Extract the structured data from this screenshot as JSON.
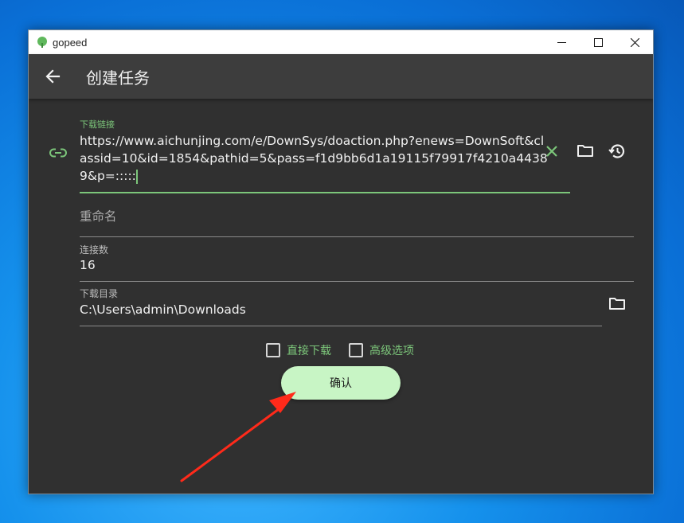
{
  "window": {
    "title": "gopeed"
  },
  "appbar": {
    "title": "创建任务"
  },
  "form": {
    "url_label": "下载链接",
    "url_value": "https://www.aichunjing.com/e/DownSys/doaction.php?enews=DownSoft&classid=10&id=1854&pathid=5&pass=f1d9bb6d1a19115f79917f4210a44389&p=:::::",
    "rename_placeholder": "重命名",
    "connections_label": "连接数",
    "connections_value": "16",
    "dir_label": "下载目录",
    "dir_value": "C:\\Users\\admin\\Downloads",
    "direct_download_label": "直接下载",
    "advanced_label": "高级选项",
    "confirm_label": "确认"
  },
  "icons": [
    "link-icon",
    "clear-icon",
    "folder-icon",
    "history-icon",
    "back-arrow-icon",
    "minimize-icon",
    "maximize-icon",
    "close-icon"
  ],
  "colors": {
    "accent": "#7cc67a",
    "button": "#c8f5c5",
    "surface": "#303030",
    "appbar": "#3d3d3d"
  }
}
